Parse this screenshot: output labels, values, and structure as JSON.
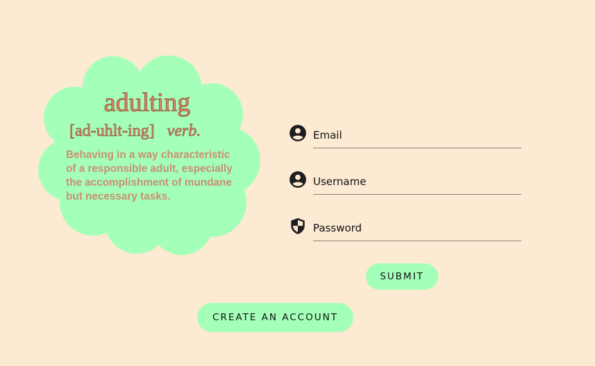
{
  "definition": {
    "word": "adulting",
    "pronunciation": "[ad-uhlt-ing]",
    "part_of_speech": "verb.",
    "meaning": "Behaving in a way characteristic of a responsible adult, especially the accomplishment of mundane but necessary tasks."
  },
  "form": {
    "email_placeholder": "Email",
    "username_placeholder": "Username",
    "password_placeholder": "Password",
    "submit_label": "SUBMIT"
  },
  "create_account_label": "CREATE AN ACCOUNT",
  "colors": {
    "background": "#fcead3",
    "cloud": "#a4ffb8",
    "word_text": "#d7896a",
    "button": "#a4ffb8"
  },
  "icons": {
    "email": "account-circle-icon",
    "username": "account-circle-icon",
    "password": "shield-icon"
  }
}
